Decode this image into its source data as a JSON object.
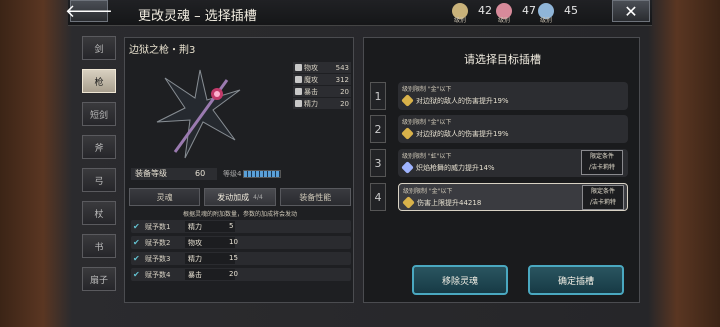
{
  "header": {
    "title": "更改灵魂 – 选择插槽",
    "currencies": [
      {
        "label": "级别",
        "value": "42",
        "color": "#c9b27a"
      },
      {
        "label": "级别",
        "value": "47",
        "color": "#d88a9a"
      },
      {
        "label": "级别",
        "value": "45",
        "color": "#8fb5d8"
      }
    ]
  },
  "tabs": [
    "剑",
    "枪",
    "短剑",
    "斧",
    "弓",
    "杖",
    "书",
    "扇子"
  ],
  "weapon": {
    "name": "边狱之枪・荆3",
    "stats": [
      {
        "name": "物攻",
        "value": "543"
      },
      {
        "name": "魔攻",
        "value": "312"
      },
      {
        "name": "暴击",
        "value": "20"
      },
      {
        "name": "精力",
        "value": "20"
      }
    ],
    "equip_level_label": "装备等级",
    "equip_level": "60",
    "level_label": "等级",
    "level_value": "4"
  },
  "subtabs": {
    "soul": "灵魂",
    "activate": "发动加成",
    "activate_count": "4/4",
    "performance": "装备性能"
  },
  "hint": "根据灵魂的附加数量，参数的加成将会发动",
  "bonuses": [
    {
      "name": "赋予数1",
      "stat": "精力",
      "value": "5"
    },
    {
      "name": "赋予数2",
      "stat": "物攻",
      "value": "10"
    },
    {
      "name": "赋予数3",
      "stat": "精力",
      "value": "15"
    },
    {
      "name": "赋予数4",
      "stat": "暴击",
      "value": "20"
    }
  ],
  "right": {
    "title": "请选择目标插槽",
    "slots": [
      {
        "num": "1",
        "req": "级别限制 \"金\"以下",
        "effect": "对边狱的敌人的伤害提升19%",
        "icon_color": "#d9b24a",
        "cond": ""
      },
      {
        "num": "2",
        "req": "级别限制 \"金\"以下",
        "effect": "对边狱的敌人的伤害提升19%",
        "icon_color": "#d9b24a",
        "cond": ""
      },
      {
        "num": "3",
        "req": "级别限制 \"虹\"以下",
        "effect": "炽焰枪舞的威力提升14%",
        "icon_color": "#9fb4ff",
        "cond": "限定条件\n/洁卡莉特"
      },
      {
        "num": "4",
        "req": "级别限制 \"金\"以下",
        "effect": "伤害上限提升44218",
        "icon_color": "#d9b24a",
        "cond": "限定条件\n/洁卡莉特"
      }
    ],
    "remove_btn": "移除灵魂",
    "confirm_btn": "确定插槽"
  }
}
